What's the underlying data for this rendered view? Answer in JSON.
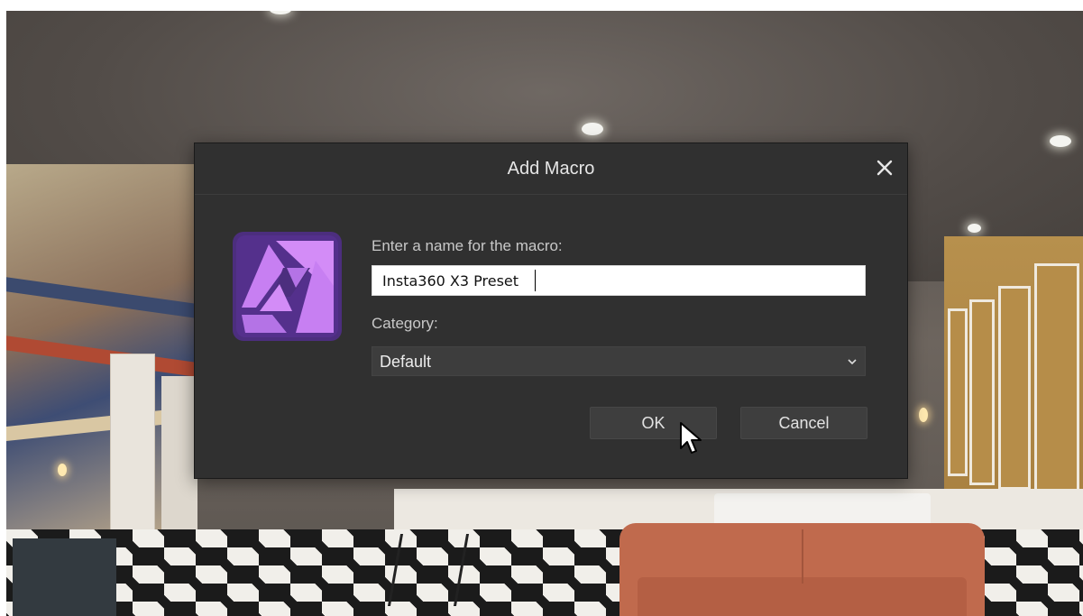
{
  "dialog": {
    "title": "Add Macro",
    "close_icon": "close-icon",
    "app_icon": "affinity-photo-icon",
    "name_label": "Enter a name for the macro:",
    "name_value": "Insta360 X3 Preset",
    "category_label": "Category:",
    "category_value": "Default",
    "ok_label": "OK",
    "cancel_label": "Cancel"
  },
  "colors": {
    "dialog_bg": "#303030",
    "app_icon_bg": "#4c2e7e",
    "app_icon_accent": "#c77ff2",
    "button_bg": "#3e3e3e"
  }
}
